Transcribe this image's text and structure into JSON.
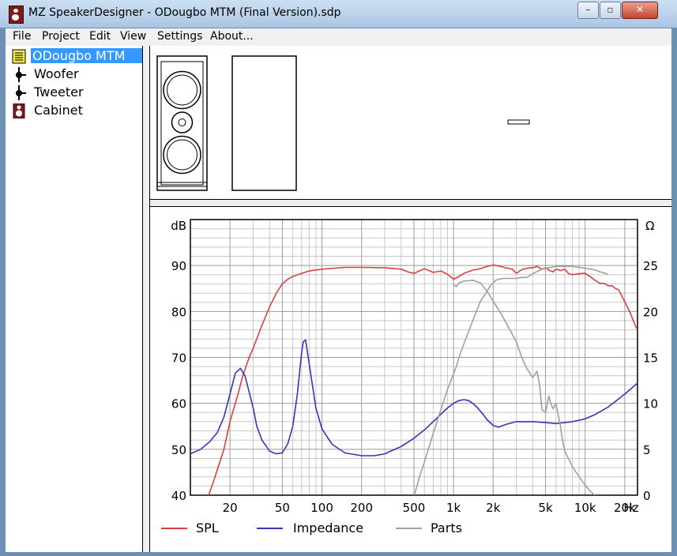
{
  "window": {
    "title": "MZ SpeakerDesigner - ODougbo MTM (Final Version).sdp",
    "minimize_glyph": "–",
    "maximize_glyph": "▫",
    "close_glyph": "✕"
  },
  "menu": [
    "File",
    "Project",
    "Edit",
    "View",
    "Settings",
    "About..."
  ],
  "tree": [
    {
      "label": "ODougbo MTM",
      "icon": "project-icon",
      "selected": true
    },
    {
      "label": "Woofer",
      "icon": "driver-node-icon",
      "selected": false
    },
    {
      "label": "Tweeter",
      "icon": "driver-node-icon",
      "selected": false
    },
    {
      "label": "Cabinet",
      "icon": "cabinet-icon",
      "selected": false
    }
  ],
  "chart_data": {
    "type": "line",
    "xscale": "log",
    "xlim": [
      10,
      25000
    ],
    "ylim": [
      40,
      100
    ],
    "y2lim": [
      0,
      30
    ],
    "ylabel": "dB",
    "y2label": "Ω",
    "x_unit": "Hz",
    "x_ticks": [
      {
        "v": 20,
        "l": "20"
      },
      {
        "v": 50,
        "l": "50"
      },
      {
        "v": 100,
        "l": "100"
      },
      {
        "v": 200,
        "l": "200"
      },
      {
        "v": 500,
        "l": "500"
      },
      {
        "v": 1000,
        "l": "1k"
      },
      {
        "v": 2000,
        "l": "2k"
      },
      {
        "v": 5000,
        "l": "5k"
      },
      {
        "v": 10000,
        "l": "10k"
      },
      {
        "v": 20000,
        "l": "20k"
      }
    ],
    "y_ticks": [
      40,
      50,
      60,
      70,
      80,
      90
    ],
    "y2_ticks": [
      0,
      5,
      10,
      15,
      20,
      25
    ],
    "grid": true,
    "legend_position": "bottom",
    "series": [
      {
        "name": "SPL",
        "axis": "left",
        "color": "#d94040",
        "x": [
          13,
          15,
          18,
          20,
          23,
          25,
          28,
          30,
          35,
          40,
          45,
          50,
          55,
          60,
          70,
          80,
          100,
          150,
          200,
          300,
          400,
          450,
          500,
          600,
          700,
          800,
          900,
          1000,
          1100,
          1200,
          1400,
          1600,
          1800,
          2000,
          2200,
          2500,
          2800,
          3000,
          3300,
          3600,
          4000,
          4300,
          4700,
          5000,
          5300,
          5700,
          6000,
          6500,
          7000,
          7500,
          8000,
          9000,
          10000,
          11000,
          12000,
          13000,
          14000,
          15000,
          16000,
          17000,
          18000,
          20000,
          22000,
          24000,
          25000
        ],
        "y": [
          38,
          43,
          50,
          56,
          62,
          66,
          70,
          72,
          77,
          81,
          84,
          86,
          87,
          87.6,
          88.3,
          88.8,
          89.2,
          89.6,
          89.6,
          89.5,
          89.2,
          88.6,
          88.3,
          89.3,
          88.5,
          88.8,
          88.1,
          87,
          87.6,
          88.3,
          89,
          89.3,
          89.8,
          90.1,
          89.9,
          89.5,
          89.2,
          88.3,
          89.1,
          89.4,
          89.5,
          89.8,
          89.2,
          89.5,
          89,
          88.6,
          89.2,
          88.9,
          89.2,
          88.2,
          88,
          88.2,
          88.3,
          87.5,
          86.7,
          86.1,
          86.1,
          85.6,
          85.6,
          85,
          84.7,
          82.1,
          79.7,
          77,
          76
        ]
      },
      {
        "name": "Impedance",
        "axis": "right",
        "color": "#3535b8",
        "x": [
          10,
          12,
          14,
          16,
          18,
          20,
          22,
          24,
          26,
          28,
          30,
          32,
          35,
          40,
          45,
          50,
          55,
          60,
          65,
          70,
          72,
          75,
          80,
          90,
          100,
          120,
          150,
          200,
          250,
          300,
          400,
          500,
          600,
          700,
          800,
          900,
          1000,
          1100,
          1200,
          1300,
          1400,
          1500,
          1700,
          1800,
          2000,
          2200,
          2500,
          3000,
          4000,
          5000,
          6000,
          7000,
          8000,
          10000,
          12000,
          15000,
          20000,
          25000
        ],
        "y": [
          4.5,
          5,
          5.8,
          6.8,
          8.5,
          11,
          13.3,
          13.8,
          13,
          11.2,
          9.5,
          7.5,
          6,
          4.8,
          4.5,
          4.6,
          5.6,
          7.5,
          11,
          15.5,
          16.7,
          16.9,
          14.3,
          9.5,
          7.2,
          5.5,
          4.6,
          4.3,
          4.3,
          4.5,
          5.3,
          6.2,
          7.1,
          8,
          8.8,
          9.5,
          10,
          10.3,
          10.4,
          10.3,
          10,
          9.6,
          8.7,
          8.2,
          7.6,
          7.4,
          7.7,
          8,
          8,
          7.9,
          7.8,
          7.9,
          8,
          8.3,
          8.8,
          9.6,
          11,
          12.2
        ]
      },
      {
        "name": "Parts",
        "axis": "right",
        "color": "#a0a0a0",
        "segments": [
          {
            "x": [
              500,
              550,
              600,
              700,
              800,
              900,
              1000,
              1050,
              1100,
              1200,
              1300,
              1400,
              1500,
              1600,
              1800,
              1900,
              2000,
              2100,
              2200,
              2400,
              2700,
              3000,
              3300,
              3600,
              4000,
              4400,
              4700,
              5000,
              5500,
              6000,
              6500,
              7000,
              8000,
              9000,
              10000,
              11000,
              12000,
              13000,
              14000,
              15000
            ],
            "y": [
              -0.2,
              2,
              3.6,
              6.7,
              9.3,
              11.5,
              13.2,
              14,
              15,
              16.5,
              17.8,
              19,
              20.1,
              21.1,
              22.2,
              22.8,
              23.1,
              23.4,
              23.5,
              23.6,
              23.6,
              23.6,
              23.7,
              23.7,
              24.1,
              24.4,
              24.6,
              24.7,
              24.8,
              24.9,
              24.9,
              24.9,
              24.9,
              24.8,
              24.7,
              24.6,
              24.5,
              24.3,
              24.2,
              24
            ]
          },
          {
            "x": [
              1000,
              1050,
              1100,
              1200,
              1400,
              1600,
              1800,
              2000,
              2200,
              2500,
              3000,
              3300,
              3600,
              4000,
              4300,
              4500,
              4700,
              5000,
              5300,
              5500,
              5700,
              6000,
              6200,
              6500,
              6700,
              7000,
              8000,
              9000,
              10000,
              11000,
              12000,
              13000,
              14000,
              14500
            ],
            "y": [
              22.9,
              22.7,
              23.1,
              23.3,
              23.4,
              23.1,
              22.2,
              21.1,
              20.2,
              18.8,
              16.7,
              15,
              13.8,
              12.8,
              13.5,
              12.1,
              9.3,
              9,
              10.8,
              9.9,
              9.4,
              10,
              9,
              7.5,
              6.1,
              4.8,
              3.1,
              2,
              1.1,
              0.4,
              -0.1,
              -0.4,
              -0.6,
              -0.7
            ]
          }
        ]
      }
    ]
  }
}
